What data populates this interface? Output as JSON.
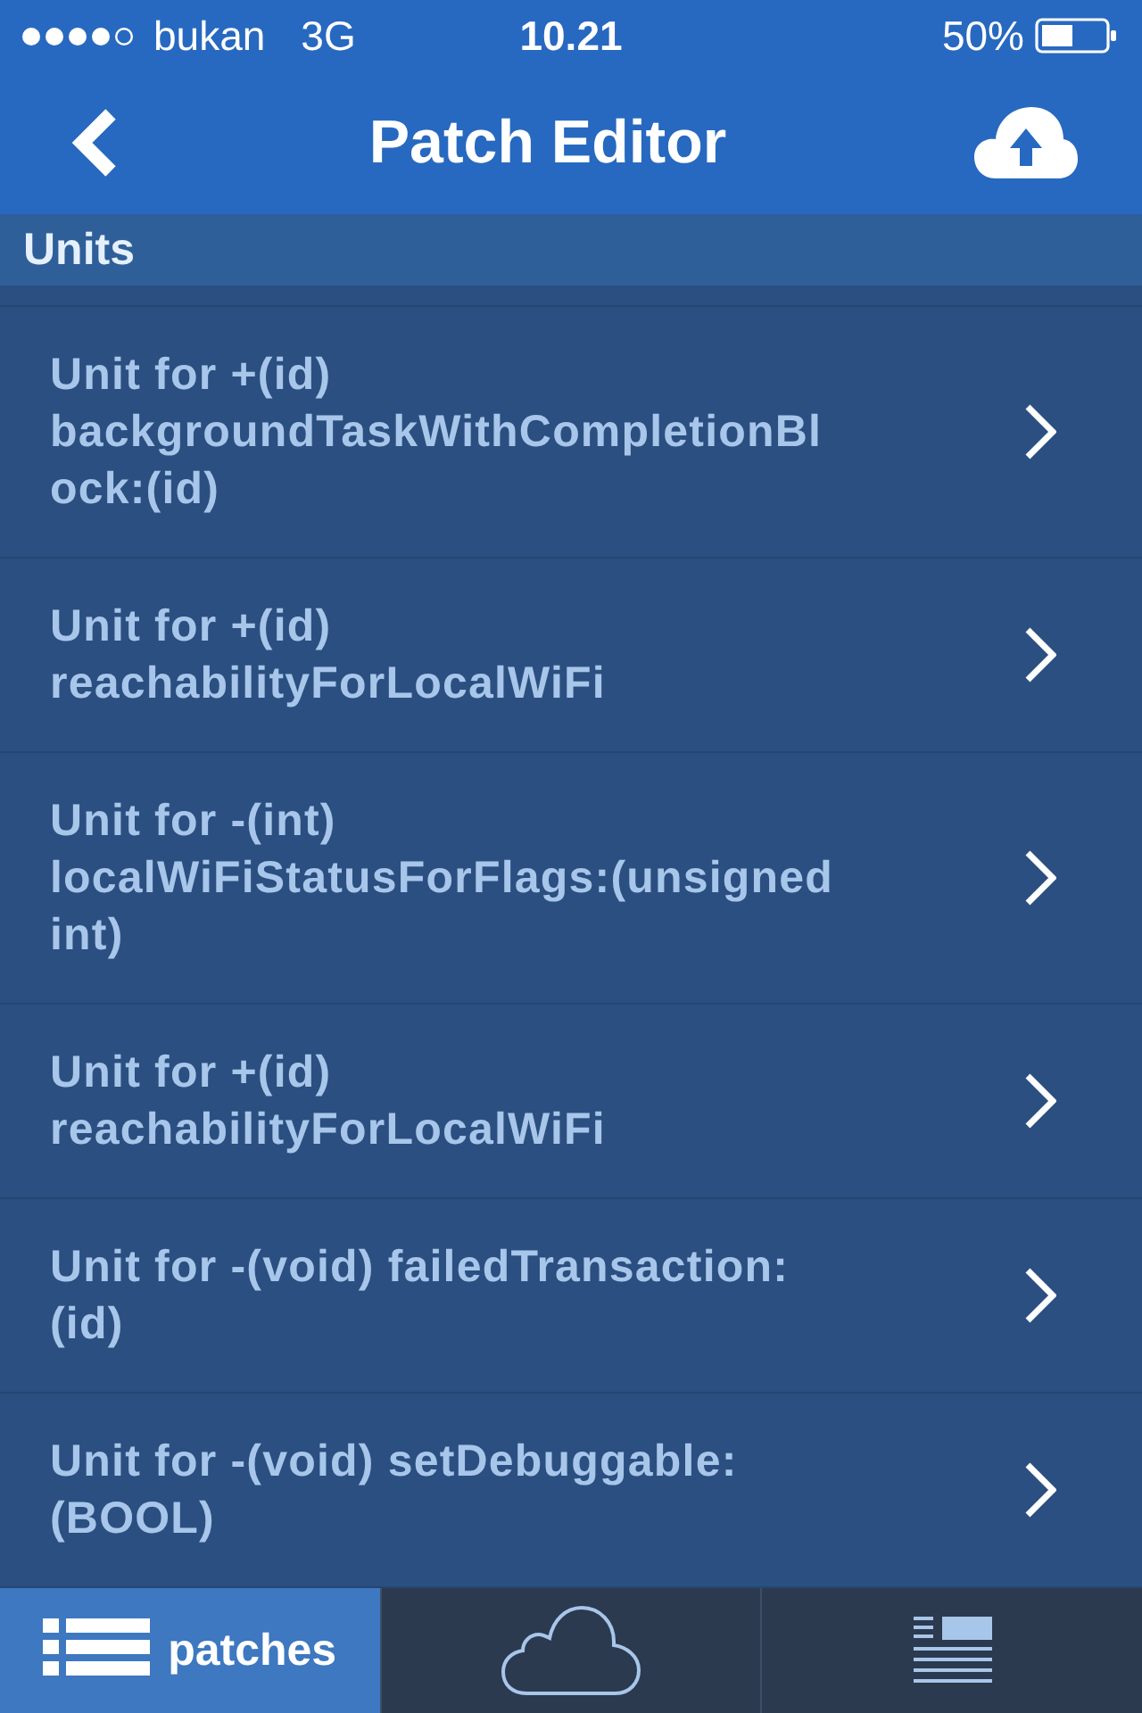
{
  "status_bar": {
    "carrier": "bukan",
    "network": "3G",
    "time": "10.21",
    "battery": "50%"
  },
  "nav_bar": {
    "title": "Patch Editor"
  },
  "section": {
    "title": "Units"
  },
  "units": [
    {
      "text": "Unit for +(id) backgroundTaskWithCompletionBlock:(id)"
    },
    {
      "text": "Unit for +(id) reachabilityForLocalWiFi"
    },
    {
      "text": "Unit for -(int) localWiFiStatusForFlags:(unsigned int)"
    },
    {
      "text": "Unit for +(id) reachabilityForLocalWiFi"
    },
    {
      "text": "Unit for -(void) failedTransaction:(id)"
    },
    {
      "text": "Unit for -(void) setDebuggable:(BOOL)"
    }
  ],
  "tab_bar": [
    {
      "label": "patches",
      "selected": true
    },
    {
      "selected": false
    },
    {
      "selected": false
    }
  ]
}
